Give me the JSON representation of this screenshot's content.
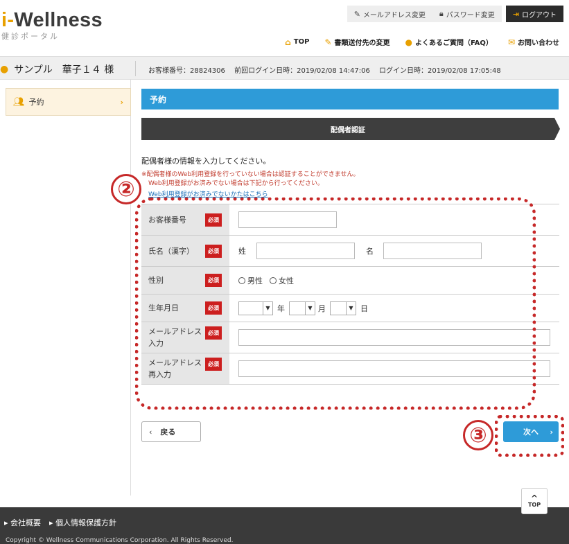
{
  "header": {
    "logo_i": "i-",
    "logo_main": "Wellness",
    "logo_sub": "健診ポータル",
    "topbar": {
      "email_change": "メールアドレス変更",
      "password_change": "パスワード変更",
      "logout": "ログアウト"
    },
    "subnav": {
      "top": "TOP",
      "doc_address": "書類送付先の変更",
      "faq": "よくあるご質問（FAQ）",
      "contact": "お問い合わせ"
    }
  },
  "infobar": {
    "user_name": "サンプル　華子１４ 様",
    "customer_number": "お客様番号：28824306",
    "last_login": "前回ログイン日時：2019/02/08 14:47:06",
    "login": "ログイン日時：2019/02/08 17:05:48"
  },
  "sidebar": {
    "items": [
      {
        "label": "予約",
        "icon": "people-icon"
      }
    ]
  },
  "main": {
    "page_title": "予約",
    "step_label": "配偶者認証",
    "intro": "配偶者様の情報を入力してください。",
    "warning_1": "※配偶者様のWeb利用登録を行っていない場合は認証することができません。",
    "warning_2": "Web利用登録がお済みでない場合は下記から行ってください。",
    "warning_link": "Web利用登録がお済みでないかたはこちら",
    "required_badge": "必須",
    "form": {
      "customer_number_label": "お客様番号",
      "customer_number_value": "",
      "name_label": "氏名（漢字）",
      "last_name_prefix": "姓",
      "last_name_value": "",
      "first_name_prefix": "名",
      "first_name_value": "",
      "gender_label": "性別",
      "gender_options": [
        "男性",
        "女性"
      ],
      "birthdate_label": "生年月日",
      "year_unit": "年",
      "month_unit": "月",
      "day_unit": "日",
      "email_label": "メールアドレス入力",
      "email_label_a": "メールアドレス",
      "email_label_b": "入力",
      "email_value": "",
      "email_confirm_label_a": "メールアドレス",
      "email_confirm_label_b": "再入力",
      "email_confirm_value": ""
    },
    "back_button": "戻る",
    "next_button": "次へ"
  },
  "annotations": {
    "marker_2": "②",
    "marker_3": "③",
    "color": "#c62828"
  },
  "footer": {
    "page_top": "TOP",
    "links": [
      "会社概要",
      "個人情報保護方針"
    ],
    "copyright": "Copyright © Wellness Communications Corporation. All Rights Reserved."
  },
  "colors": {
    "accent_blue": "#2e9bd8",
    "accent_orange": "#e8a000",
    "required_red": "#cc1f1f",
    "dark": "#3e3e3e"
  }
}
